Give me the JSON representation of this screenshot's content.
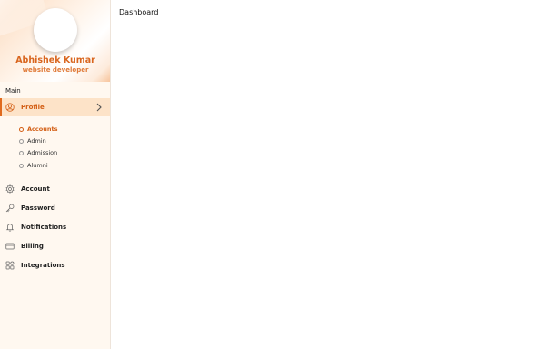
{
  "user": {
    "name": "Abhishek Kumar",
    "role": "website developer"
  },
  "sidebar": {
    "section_label": "Main",
    "profile": {
      "label": "Profile",
      "icon": "user-circle-icon"
    },
    "sub_items": [
      {
        "label": "Accounts",
        "active": true
      },
      {
        "label": "Admin"
      },
      {
        "label": "Admission"
      },
      {
        "label": "Alumni"
      }
    ],
    "items": [
      {
        "label": "Account",
        "icon": "gear-icon"
      },
      {
        "label": "Password",
        "icon": "key-icon"
      },
      {
        "label": "Notifications",
        "icon": "bell-icon"
      },
      {
        "label": "Billing",
        "icon": "card-icon"
      },
      {
        "label": "Integrations",
        "icon": "apps-icon"
      }
    ]
  },
  "main": {
    "title": "Dashboard"
  },
  "colors": {
    "accent": "#d9661f",
    "sidebar_bg": "#fff8f0",
    "active_bg": "#fde3c8"
  }
}
